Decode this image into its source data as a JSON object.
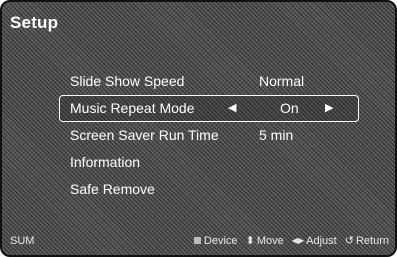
{
  "header": {
    "title": "Setup"
  },
  "menu": {
    "items": [
      {
        "label": "Slide Show Speed",
        "value": "Normal"
      },
      {
        "label": "Music Repeat Mode",
        "value": "On"
      },
      {
        "label": "Screen Saver Run Time",
        "value": "5 min"
      },
      {
        "label": "Information",
        "value": ""
      },
      {
        "label": "Safe Remove",
        "value": ""
      }
    ],
    "selected_index": 1
  },
  "footer": {
    "source": "SUM",
    "hints": [
      {
        "icon": "square-icon",
        "label": "Device"
      },
      {
        "icon": "up-down-arrow-icon",
        "label": "Move"
      },
      {
        "icon": "left-right-arrow-icon",
        "label": "Adjust"
      },
      {
        "icon": "return-icon",
        "label": "Return"
      }
    ]
  }
}
